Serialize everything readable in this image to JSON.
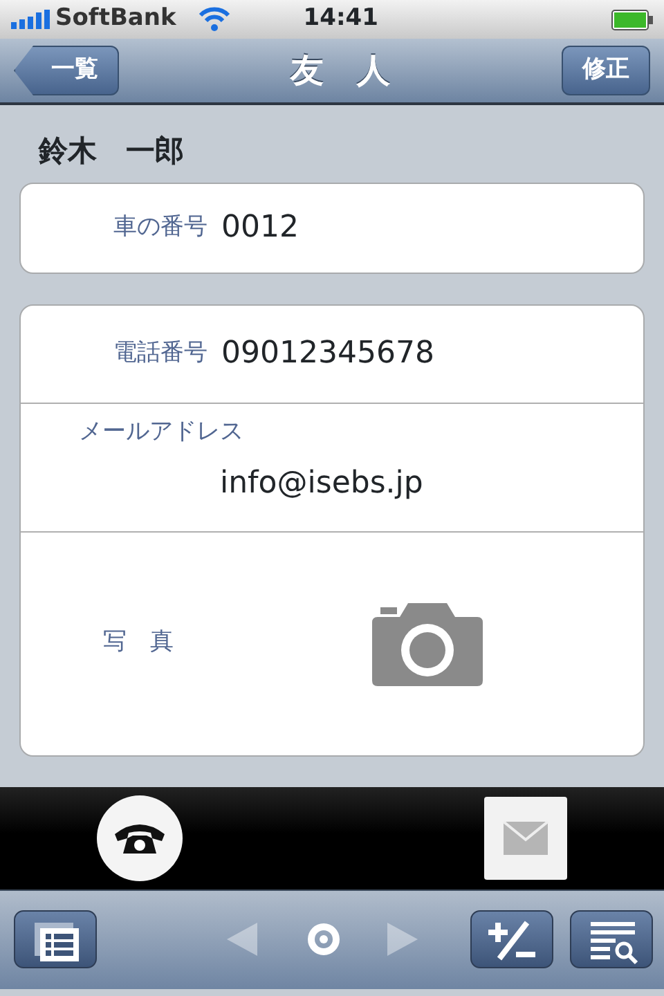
{
  "status_bar": {
    "carrier": "SoftBank",
    "time": "14:41"
  },
  "nav_bar": {
    "back": "一覧",
    "title": "友　人",
    "edit": "修正"
  },
  "name": "鈴木　一郎",
  "groups": [
    {
      "rows": [
        {
          "kind": "inline",
          "label": "車の番号",
          "value": "0012"
        }
      ]
    },
    {
      "rows": [
        {
          "kind": "inline",
          "label": "電話番号",
          "value": "09012345678"
        },
        {
          "kind": "stacked",
          "label": "メールアドレス",
          "value": "info@isebs.jp"
        },
        {
          "kind": "photo",
          "label": "写　真"
        }
      ]
    }
  ],
  "action_bar": [
    {
      "kind": "phone"
    },
    {
      "kind": "mail"
    }
  ],
  "toolbar": [
    {
      "kind": "list",
      "disabled": false
    },
    {
      "kind": "prev",
      "disabled": true
    },
    {
      "kind": "target",
      "disabled": false
    },
    {
      "kind": "next",
      "disabled": true
    },
    {
      "kind": "plusminus",
      "disabled": false
    },
    {
      "kind": "search-list",
      "disabled": false
    }
  ]
}
